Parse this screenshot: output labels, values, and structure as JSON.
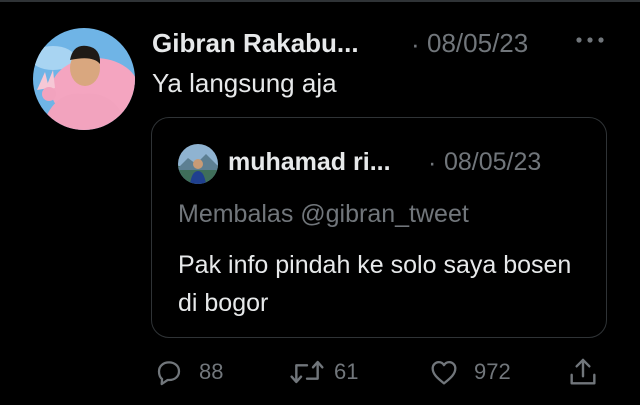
{
  "tweet": {
    "author_name": "Gibran Rakabu...",
    "separator": "·",
    "date": "08/05/23",
    "more_label": "···",
    "text": "Ya langsung aja",
    "avatar": "profile-photo"
  },
  "quoted_tweet": {
    "author_name": "muhamad ri...",
    "separator": "·",
    "date": "08/05/23",
    "replying_to": "Membalas @gibran_tweet",
    "text": "Pak info pindah ke solo saya bosen di bogor",
    "avatar": "profile-photo"
  },
  "actions": {
    "reply_count": "88",
    "retweet_count": "61",
    "like_count": "972"
  },
  "colors": {
    "background": "#000000",
    "text_primary": "#e7e9ea",
    "text_secondary": "#71767b",
    "border": "#2f3336"
  }
}
